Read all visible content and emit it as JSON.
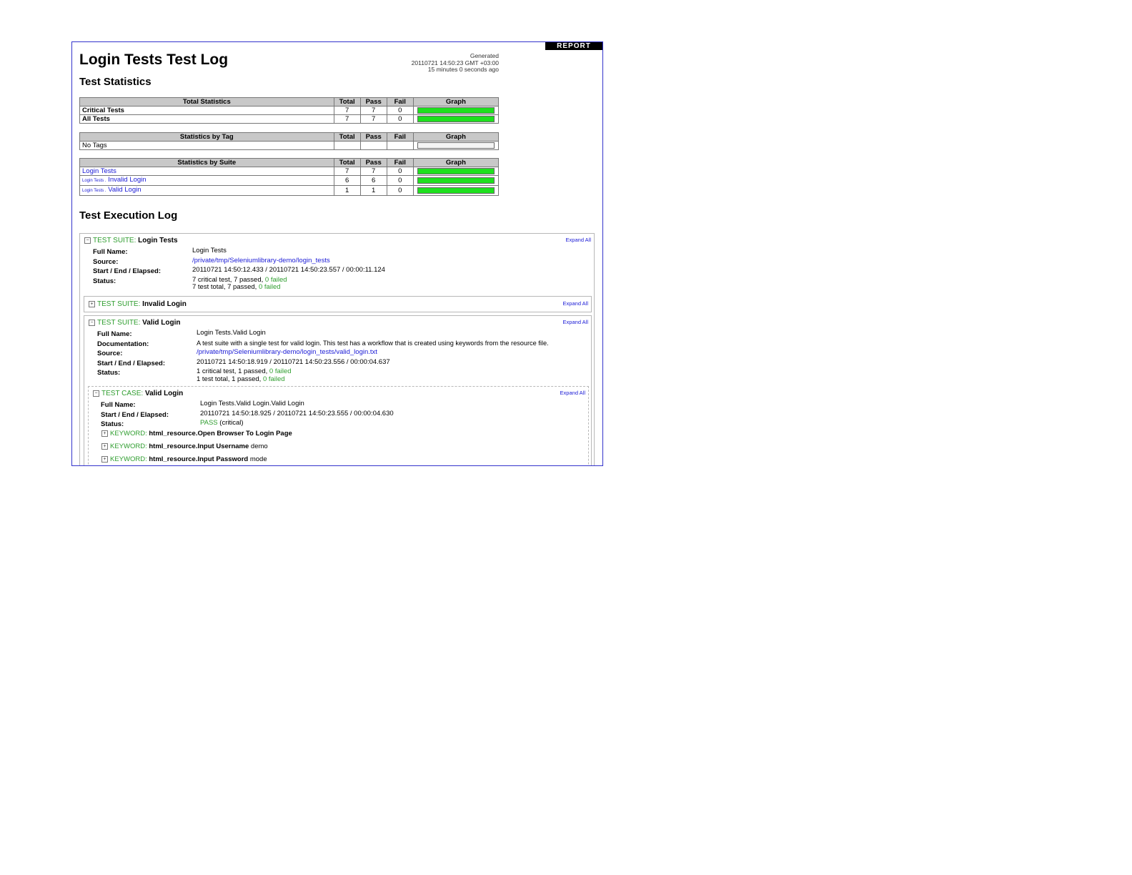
{
  "report_button": "REPORT",
  "title": "Login Tests Test Log",
  "generated": {
    "label": "Generated",
    "timestamp": "20110721 14:50:23 GMT +03:00",
    "ago": "15 minutes 0 seconds ago"
  },
  "stats_heading": "Test Statistics",
  "cols": {
    "total": "Total",
    "pass": "Pass",
    "fail": "Fail",
    "graph": "Graph"
  },
  "total_stats": {
    "header": "Total Statistics",
    "rows": [
      {
        "name": "Critical Tests",
        "total": "7",
        "pass": "7",
        "fail": "0",
        "pass_fraction": 1.0
      },
      {
        "name": "All Tests",
        "total": "7",
        "pass": "7",
        "fail": "0",
        "pass_fraction": 1.0
      }
    ]
  },
  "tag_stats": {
    "header": "Statistics by Tag",
    "empty": "No Tags"
  },
  "suite_stats": {
    "header": "Statistics by Suite",
    "rows": [
      {
        "prefix": "",
        "name": "Login Tests",
        "total": "7",
        "pass": "7",
        "fail": "0",
        "pass_fraction": 1.0
      },
      {
        "prefix": "Login Tests .",
        "name": "Invalid Login",
        "total": "6",
        "pass": "6",
        "fail": "0",
        "pass_fraction": 1.0
      },
      {
        "prefix": "Login Tests .",
        "name": "Valid Login",
        "total": "1",
        "pass": "1",
        "fail": "0",
        "pass_fraction": 1.0
      }
    ]
  },
  "exec_heading": "Test Execution Log",
  "expand_all": "Expand All",
  "labels": {
    "full_name": "Full Name:",
    "documentation": "Documentation:",
    "source": "Source:",
    "start_end": "Start / End / Elapsed:",
    "status": "Status:"
  },
  "suite_login": {
    "kind": "TEST SUITE:",
    "name": "Login Tests",
    "full_name": "Login Tests",
    "source": "/private/tmp/Seleniumlibrary-demo/login_tests",
    "times": "20110721 14:50:12.433  /  20110721 14:50:23.557  /  00:00:11.124",
    "status_line1": "7 critical test, 7 passed, ",
    "status_line1_failed": "0 failed",
    "status_line2": "7 test total, 7 passed, ",
    "status_line2_failed": "0 failed"
  },
  "suite_invalid": {
    "kind": "TEST SUITE:",
    "name": "Invalid Login"
  },
  "suite_valid": {
    "kind": "TEST SUITE:",
    "name": "Valid Login",
    "full_name": "Login Tests.Valid Login",
    "documentation": "A test suite with a single test for valid login. This test has a workflow that is created using keywords from the resource file.",
    "source": "/private/tmp/Seleniumlibrary-demo/login_tests/valid_login.txt",
    "times": "20110721 14:50:18.919  /  20110721 14:50:23.556  /  00:00:04.637",
    "status_line1": "1 critical test, 1 passed, ",
    "status_line1_failed": "0 failed",
    "status_line2": "1 test total, 1 passed, ",
    "status_line2_failed": "0 failed"
  },
  "test_case": {
    "kind": "TEST CASE:",
    "name": "Valid Login",
    "full_name": "Login Tests.Valid Login.Valid Login",
    "times": "20110721 14:50:18.925  /  20110721 14:50:23.555  /  00:00:04.630",
    "status_pass": "PASS",
    "status_crit": " (critical)"
  },
  "keywords": [
    {
      "kind": "KEYWORD:",
      "name": "html_resource.Open Browser To Login Page",
      "args": ""
    },
    {
      "kind": "KEYWORD:",
      "name": "html_resource.Input Username",
      "args": " demo"
    },
    {
      "kind": "KEYWORD:",
      "name": "html_resource.Input Password",
      "args": " mode"
    }
  ]
}
